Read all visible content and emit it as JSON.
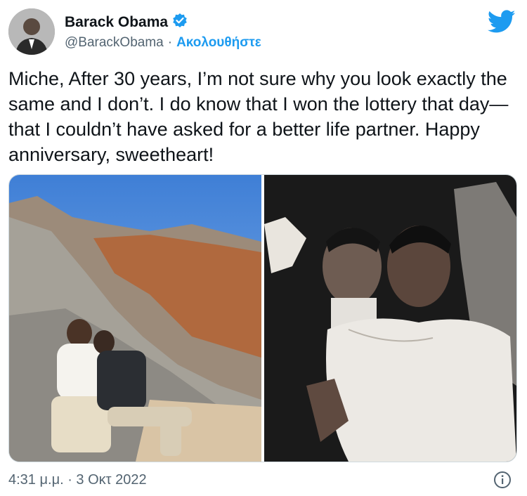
{
  "author": {
    "display_name": "Barack Obama",
    "handle": "@BarackObama",
    "separator": "·",
    "follow_label": "Ακολουθήστε",
    "verified_icon": "verified-badge-icon"
  },
  "tweet": {
    "text": "Miche, After 30 years, I’m not sure why you look exactly the same and I don’t. I do know that I won the lottery that day—that I couldn’t have asked for a better life partner. Happy anniversary, sweetheart!",
    "timestamp": "4:31 μ.μ. · 3 Οκτ 2022"
  },
  "colors": {
    "twitter_blue": "#1d9bf0",
    "text_primary": "#0f1419",
    "text_secondary": "#536471"
  },
  "icons": {
    "logo": "twitter-bird-icon",
    "info": "info-icon"
  }
}
